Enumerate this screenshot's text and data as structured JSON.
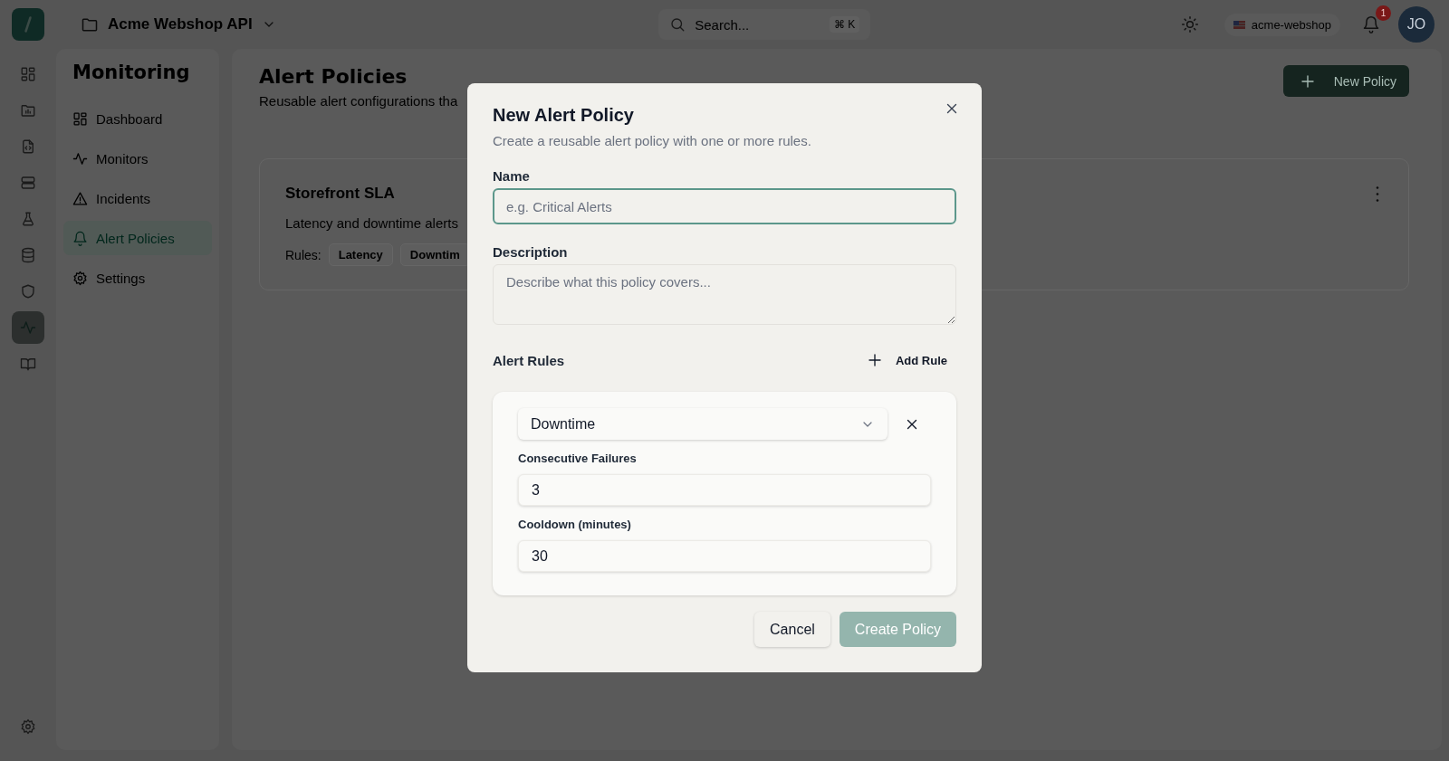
{
  "topbar": {
    "project": "Acme Webshop API",
    "search": {
      "placeholder": "Search...",
      "shortcut": "⌘ K"
    },
    "workspace": "acme-webshop",
    "notifications": "1",
    "avatar": "JO"
  },
  "rail": [
    {
      "kind": "grid",
      "selected": false
    },
    {
      "kind": "folder",
      "selected": false
    },
    {
      "kind": "file-code",
      "selected": false
    },
    {
      "kind": "server",
      "selected": false
    },
    {
      "kind": "flask",
      "selected": false
    },
    {
      "kind": "database",
      "selected": false
    },
    {
      "kind": "shield",
      "selected": false
    },
    {
      "kind": "activity",
      "selected": true
    },
    {
      "kind": "book",
      "selected": false
    }
  ],
  "sidebar": {
    "title": "Monitoring",
    "items": [
      {
        "label": "Dashboard",
        "kind": "grid",
        "selected": false
      },
      {
        "label": "Monitors",
        "kind": "activity",
        "selected": false
      },
      {
        "label": "Incidents",
        "kind": "warning",
        "selected": false
      },
      {
        "label": "Alert Policies",
        "kind": "bell",
        "selected": true
      },
      {
        "label": "Settings",
        "kind": "gear",
        "selected": false
      }
    ]
  },
  "page": {
    "title": "Alert Policies",
    "subtitle": "Reusable alert configurations tha",
    "new_button": "New Policy",
    "policies": [
      {
        "name": "Storefront SLA",
        "description": "Latency and downtime alerts",
        "rules_label": "Rules:",
        "rules": [
          "Latency",
          "Downtim"
        ]
      }
    ]
  },
  "dialog": {
    "title": "New Alert Policy",
    "subtitle": "Create a reusable alert policy with one or more rules.",
    "name": {
      "label": "Name",
      "placeholder": "e.g. Critical Alerts",
      "focused": true
    },
    "description": {
      "label": "Description",
      "placeholder": "Describe what this policy covers..."
    },
    "rules_title": "Alert Rules",
    "add_button": "Add Rule",
    "rules": [
      {
        "type": "Downtime",
        "fields": [
          {
            "label": "Consecutive Failures",
            "value": "3"
          },
          {
            "label": "Cooldown (minutes)",
            "value": "30"
          }
        ]
      }
    ],
    "cancel": "Cancel",
    "submit": {
      "label": "Create Policy",
      "disabled": true
    }
  }
}
